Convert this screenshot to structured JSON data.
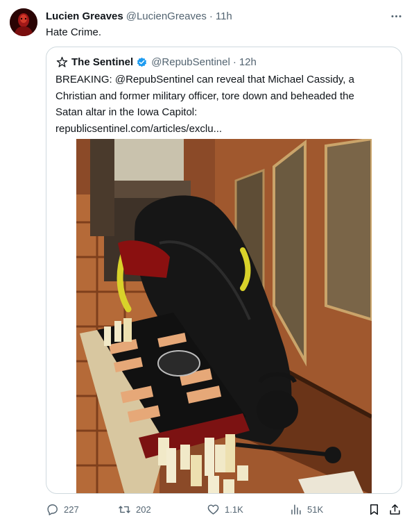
{
  "tweet": {
    "author_name": "Lucien Greaves",
    "author_handle": "@LucienGreaves",
    "separator": "·",
    "time": "11h",
    "text": "Hate Crime."
  },
  "quote": {
    "author_name": "The Sentinel",
    "author_handle": "@RepubSentinel",
    "separator": "·",
    "time": "12h",
    "text_lines": [
      "BREAKING: @RepubSentinel can reveal that Michael Cassidy, a",
      "Christian and former military officer, tore down and beheaded the",
      "Satan altar in the Iowa Capitol:",
      "republicsentinel.com/articles/exclu..."
    ]
  },
  "actions": {
    "replies": "227",
    "retweets": "202",
    "likes": "1.1K",
    "views": "51K"
  },
  "icons": {
    "more": "more-horizontal-icon",
    "verified": "verified-badge-icon",
    "reply": "reply-icon",
    "retweet": "retweet-icon",
    "like": "heart-icon",
    "views": "views-chart-icon",
    "bookmark": "bookmark-icon",
    "share": "share-icon"
  },
  "colors": {
    "text_primary": "#0f1419",
    "text_secondary": "#536471",
    "border": "#cfd9de",
    "verified_blue": "#1d9bf0"
  }
}
